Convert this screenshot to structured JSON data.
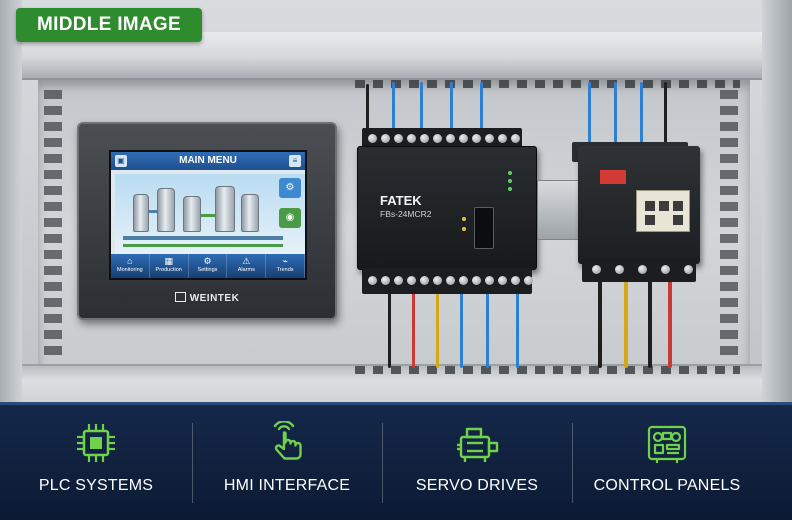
{
  "badge": {
    "label": "MIDDLE IMAGE"
  },
  "hmi": {
    "title": "MAIN MENU",
    "brand": "WEINTEK",
    "nav": [
      {
        "label": "Monitoring",
        "icon": "home-icon"
      },
      {
        "label": "Production",
        "icon": "factory-icon"
      },
      {
        "label": "Settings",
        "icon": "gear-icon"
      },
      {
        "label": "Alarms",
        "icon": "alarm-icon"
      },
      {
        "label": "Trends",
        "icon": "trend-icon"
      }
    ]
  },
  "plc": {
    "brand": "FATEK",
    "model": "FBs-24MCR2"
  },
  "features": [
    {
      "label": "PLC SYSTEMS",
      "icon": "chip-icon"
    },
    {
      "label": "HMI INTERFACE",
      "icon": "touch-hand-icon"
    },
    {
      "label": "SERVO DRIVES",
      "icon": "servo-motor-icon"
    },
    {
      "label": "CONTROL PANELS",
      "icon": "control-panel-icon"
    }
  ],
  "colors": {
    "badge_bg": "#2e8b2e",
    "footer_bg": "#15284a",
    "icon_green": "#6fd24a"
  }
}
